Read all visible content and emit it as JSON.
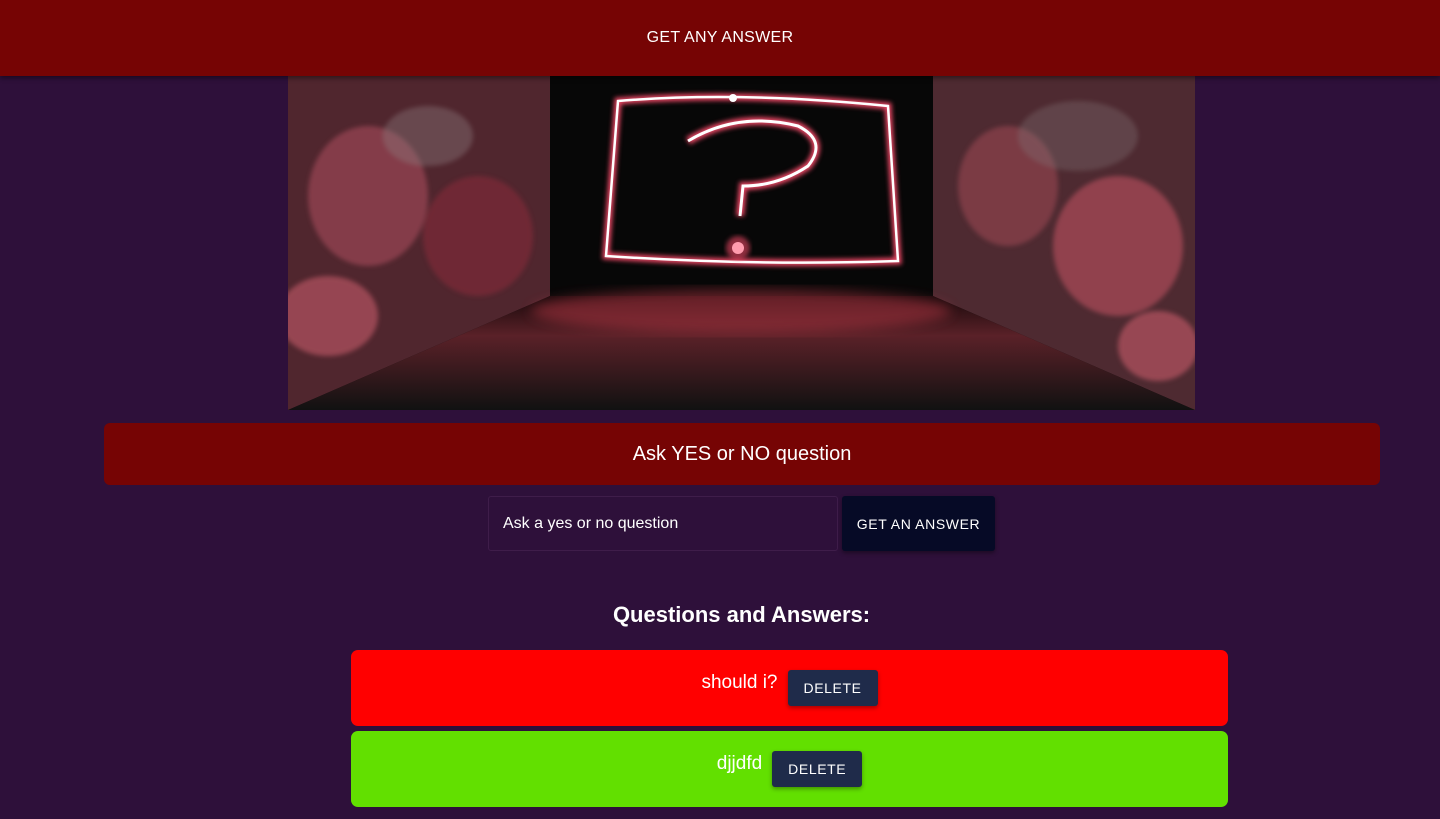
{
  "header": {
    "title": "GET ANY ANSWER"
  },
  "hero": {
    "icon": "question-mark-icon"
  },
  "banner": {
    "text": "Ask YES or NO question"
  },
  "form": {
    "placeholder": "Ask a yes or no question",
    "value": "",
    "submit_label": "GET AN ANSWER"
  },
  "qa": {
    "heading": "Questions and Answers:",
    "items": [
      {
        "question": "should i?",
        "color": "#ff0000",
        "delete_label": "DELETE"
      },
      {
        "question": "djjdfd",
        "color": "#62e000",
        "delete_label": "DELETE"
      }
    ]
  },
  "colors": {
    "background": "#2e103a",
    "appbar": "#760404",
    "banner": "#760404",
    "submit_button": "#060a26",
    "delete_button": "#1f2b4a"
  }
}
